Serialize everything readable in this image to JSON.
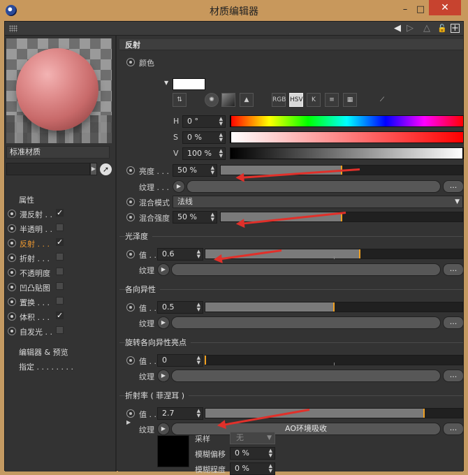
{
  "window": {
    "title": "材质编辑器",
    "min": "–",
    "max": "□",
    "close": "✕"
  },
  "toolbar": {
    "back": "◀",
    "forward": "▷",
    "up": "△",
    "lock": "🔓",
    "add": "+"
  },
  "left": {
    "material_name": "标准材质",
    "search_value": "",
    "nav_header": "属性",
    "items": [
      {
        "label": "漫反射 . .",
        "checked": true,
        "radio": true
      },
      {
        "label": "半透明 . .",
        "checked": false,
        "radio": true
      },
      {
        "label": "反射 . . .",
        "checked": true,
        "radio": true,
        "active": true
      },
      {
        "label": "折射 . . .",
        "checked": false,
        "radio": true
      },
      {
        "label": "不透明度",
        "checked": false,
        "radio": true
      },
      {
        "label": "凹凸贴图",
        "checked": false,
        "radio": true
      },
      {
        "label": "置换 . . .",
        "checked": false,
        "radio": true
      },
      {
        "label": "体积 . . .",
        "checked": true,
        "radio": true
      },
      {
        "label": "自发光 . .",
        "checked": false,
        "radio": true
      }
    ],
    "editor_preview": "编辑器 & 预览",
    "assign": "指定 . . . . . . . ."
  },
  "right": {
    "section_reflect": "反射",
    "color_label": "颜色",
    "color_value": "#ffffff",
    "modes": [
      "RGB",
      "HSV",
      "K"
    ],
    "hsv": [
      {
        "label": "H",
        "value": "0 °"
      },
      {
        "label": "S",
        "value": "0 %"
      },
      {
        "label": "V",
        "value": "100 %"
      }
    ],
    "brightness": {
      "label": "亮度 . . .",
      "value": "50 %",
      "level": 0.5
    },
    "texture_label": "纹理 . . .",
    "texture_label2": "纹理",
    "dots": "...",
    "blend_mode": {
      "label": "混合模式",
      "value": "法线"
    },
    "blend_strength": {
      "label": "混合强度",
      "value": "50 %",
      "level": 0.5
    },
    "section_gloss": "光泽度",
    "gloss": {
      "label": "值 . . .",
      "value": "0.6",
      "level": 0.6
    },
    "section_aniso": "各向异性",
    "aniso": {
      "label": "值 . . .",
      "value": "0.5",
      "level": 0.5
    },
    "section_rot": "旋转各向异性亮点",
    "rot": {
      "label": "值 . . .",
      "value": "0",
      "level": 0.0
    },
    "section_ior": "折射率 ( 菲涅耳 )",
    "ior": {
      "label": "值 . . .",
      "value": "2.7",
      "level": 0.85
    },
    "ao_texture": "AO环境吸收",
    "sample": {
      "label": "采样",
      "value": "无"
    },
    "blur_offset": {
      "label": "模糊偏移",
      "value": "0 %"
    },
    "blur_amount": {
      "label": "模糊程度",
      "value": "0 %"
    }
  },
  "colors": {
    "accent": "#f0a020",
    "arrow": "#e0302a",
    "active_nav": "#f09a30"
  }
}
